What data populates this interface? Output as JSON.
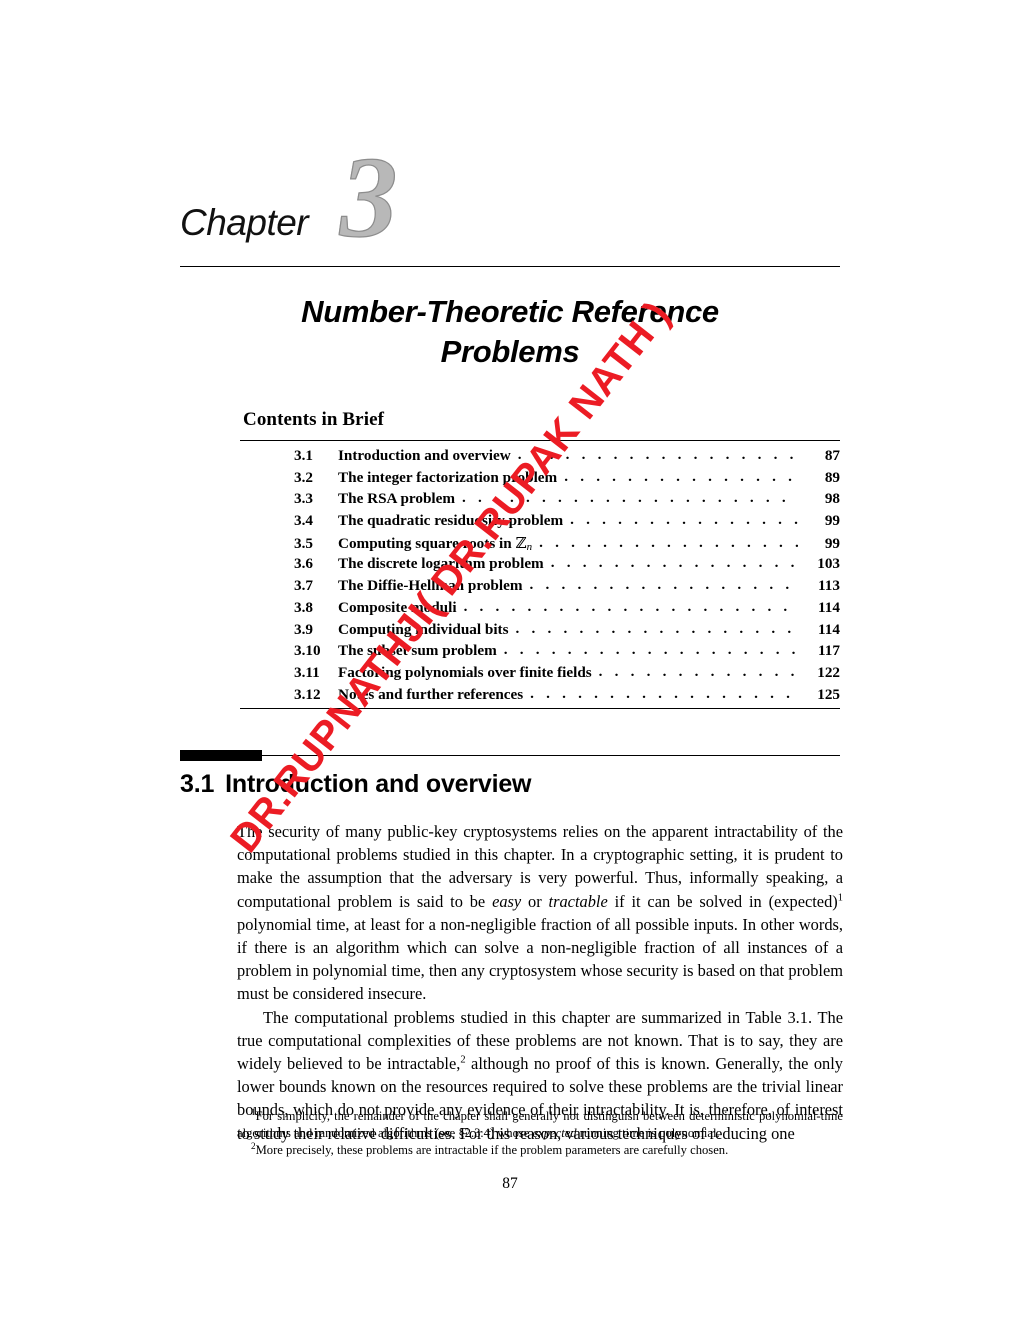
{
  "document": {
    "page_number": "87",
    "watermark_text": "DR.RUPNATHJI( DR.RUPAK NATH )",
    "watermark_color": "#ec1c24"
  },
  "chapter": {
    "label": "Chapter",
    "number": "3",
    "title_line1": "Number-Theoretic Reference",
    "title_line2": "Problems"
  },
  "contents": {
    "heading": "Contents in Brief",
    "entries": [
      {
        "num": "3.1",
        "label": "Introduction and overview",
        "page": "87"
      },
      {
        "num": "3.2",
        "label": "The integer factorization problem",
        "page": "89"
      },
      {
        "num": "3.3",
        "label": "The RSA problem",
        "page": "98"
      },
      {
        "num": "3.4",
        "label": "The quadratic residuosity problem",
        "page": "99"
      },
      {
        "num": "3.5",
        "label": "Computing square roots in ℤn",
        "page": "99"
      },
      {
        "num": "3.6",
        "label": "The discrete logarithm problem",
        "page": "103"
      },
      {
        "num": "3.7",
        "label": "The Diffie-Hellman problem",
        "page": "113"
      },
      {
        "num": "3.8",
        "label": "Composite moduli",
        "page": "114"
      },
      {
        "num": "3.9",
        "label": "Computing individual bits",
        "page": "114"
      },
      {
        "num": "3.10",
        "label": "The subset sum problem",
        "page": "117"
      },
      {
        "num": "3.11",
        "label": "Factoring polynomials over finite fields",
        "page": "122"
      },
      {
        "num": "3.12",
        "label": "Notes and further references",
        "page": "125"
      }
    ],
    "dot_leader": ". . . . . . . . . . . . . . . . . . . . . . . . . . . . . . . . . . . . . . . . . . . . . . . . . . . . . . . . . . . . . ."
  },
  "section": {
    "number": "3.1",
    "title": "Introduction and overview",
    "paragraph1": "The security of many public-key cryptosystems relies on the apparent intractability of the computational problems studied in this chapter. In a cryptographic setting, it is prudent to make the assumption that the adversary is very powerful. Thus, informally speaking, a computational problem is said to be ",
    "paragraph1_em1": "easy",
    "paragraph1_mid1": " or ",
    "paragraph1_em2": "tractable",
    "paragraph1_mid2": " if it can be solved in (expected)",
    "paragraph1_sup1": "1",
    "paragraph1_tail": " polynomial time, at least for a non-negligible fraction of all possible inputs. In other words, if there is an algorithm which can solve a non-negligible fraction of all instances of a problem in polynomial time, then any cryptosystem whose security is based on that problem must be considered insecure.",
    "paragraph2_head": "The computational problems studied in this chapter are summarized in Table 3.1. The true computational complexities of these problems are not known. That is to say, they are widely believed to be intractable,",
    "paragraph2_sup2": "2",
    "paragraph2_tail": " although no proof of this is known. Generally, the only lower bounds known on the resources required to solve these problems are the trivial linear bounds, which do not provide any evidence of their intractability. It is, therefore, of interest to study their relative difficulties. For this reason, various techniques of reducing one"
  },
  "footnotes": [
    {
      "mark": "1",
      "text_before": "For simplicity, the remainder of the chapter shall generally not distinguish between deterministic polynomial-time algorithms and randomized algorithms (see §2.3.4) whose ",
      "em": "expected",
      "text_after": " running time is polynomial."
    },
    {
      "mark": "2",
      "text_before": "More precisely, these problems are intractable if the problem parameters are carefully chosen.",
      "em": "",
      "text_after": ""
    }
  ]
}
